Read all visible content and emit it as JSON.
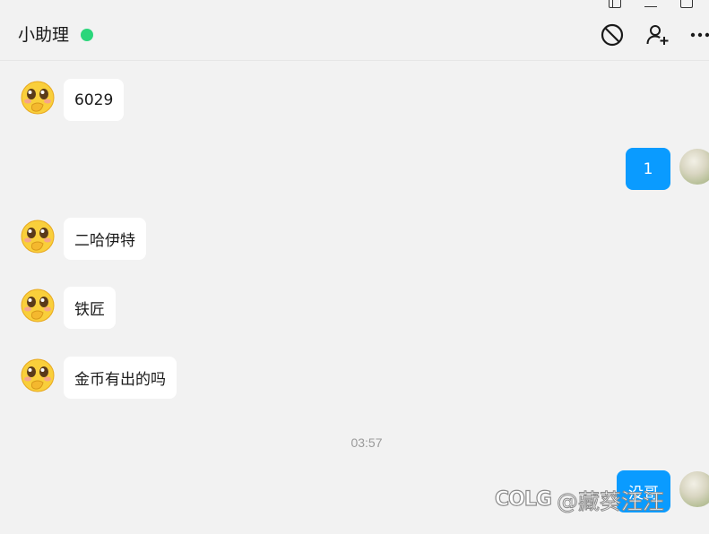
{
  "header": {
    "title": "小助理",
    "status_color": "#2bd67b"
  },
  "icons": {
    "block": "block-icon",
    "add_user": "add-user-icon",
    "more": "more-icon"
  },
  "messages": [
    {
      "side": "in",
      "text": "6029"
    },
    {
      "side": "out",
      "text": "1"
    },
    {
      "side": "in",
      "text": "二哈伊特"
    },
    {
      "side": "in",
      "text": "铁匠"
    },
    {
      "side": "in",
      "text": "金币有出的吗"
    },
    {
      "side": "out",
      "text": "没哥"
    }
  ],
  "timestamp": "03:57",
  "watermark": {
    "logo": "COLG",
    "text": "@藏葵汪汪"
  },
  "colors": {
    "background": "#f2f2f2",
    "incoming_bubble": "#ffffff",
    "outgoing_bubble": "#0a9bff"
  }
}
